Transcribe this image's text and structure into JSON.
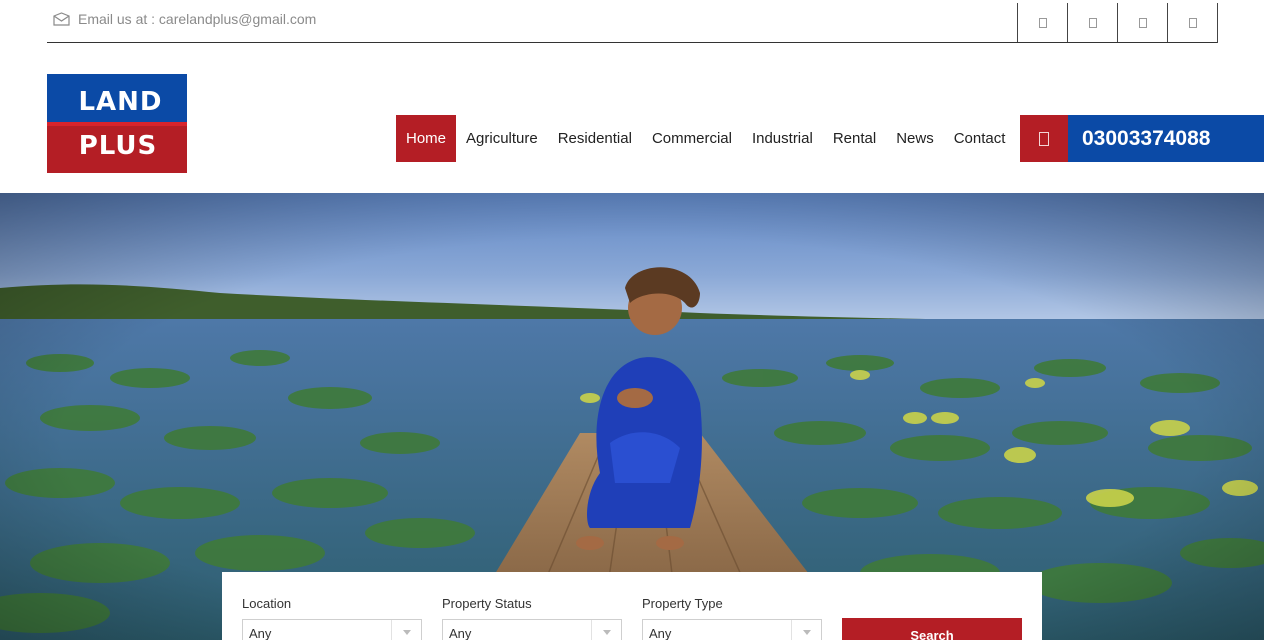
{
  "topbar": {
    "email_text": "Email us at : carelandplus@gmail.com",
    "social_icons": [
      "facebook-icon",
      "twitter-icon",
      "instagram-icon",
      "youtube-icon"
    ]
  },
  "logo": {
    "line1": "LAND",
    "line2": "PLUS"
  },
  "nav": {
    "items": [
      "Home",
      "Agriculture",
      "Residential",
      "Commercial",
      "Industrial",
      "Rental",
      "News",
      "Contact"
    ],
    "active": "Home"
  },
  "contact": {
    "phone": "03003374088",
    "icon": "phone-icon"
  },
  "search": {
    "location_label": "Location",
    "location_value": "Any",
    "status_label": "Property Status",
    "status_value": "Any",
    "type_label": "Property Type",
    "type_value": "Any",
    "button_label": "Search"
  },
  "colors": {
    "brand_red": "#b41e25",
    "brand_blue": "#0b4aa6"
  }
}
